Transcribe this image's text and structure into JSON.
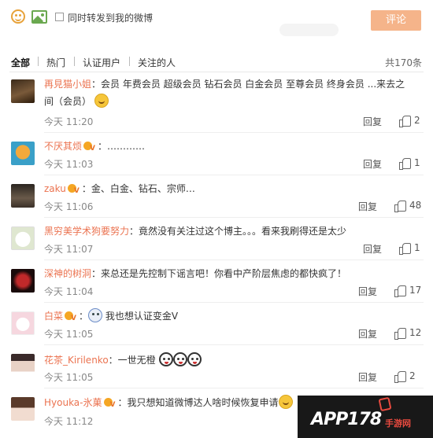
{
  "composer": {
    "emoji_icon": "smiley-icon",
    "image_icon": "picture-icon",
    "repost_label": "同时转发到我的微博",
    "submit_label": "评论"
  },
  "filters": {
    "tabs": [
      "全部",
      "热门",
      "认证用户",
      "关注的人"
    ],
    "total": "共170条"
  },
  "comments": [
    {
      "user": "再見猫小姐",
      "text": "：会员 年费会员 超级会员 钻石会员 白金会员 至尊会员 终身会员 ...来去之",
      "text2": "间（会员）",
      "time": "今天 11:20",
      "reply": "回复",
      "likes": "2"
    },
    {
      "user": "不厌其烦",
      "text": "：…………",
      "time": "今天 11:03",
      "reply": "回复",
      "likes": "1"
    },
    {
      "user": "zaku",
      "text": "：金、白金、钻石、宗师…",
      "time": "今天 11:06",
      "reply": "回复",
      "likes": "48"
    },
    {
      "user": "黑穷美学术狗要努力",
      "text": "：竟然没有关注过这个博主。。。看来我刷得还是太少",
      "time": "今天 11:07",
      "reply": "回复",
      "likes": "1"
    },
    {
      "user": "深神的树洞",
      "text": "：来总还是先控制下谣言吧！你看中产阶层焦虑的都快疯了！",
      "time": "今天 11:04",
      "reply": "回复",
      "likes": "17"
    },
    {
      "user": "白菜",
      "text": "我也想认证变金V",
      "time": "今天 11:05",
      "reply": "回复",
      "likes": "12"
    },
    {
      "user": "花茶_Kirilenko",
      "text": "：一世无橙",
      "time": "今天 11:05",
      "reply": "回复",
      "likes": "2"
    },
    {
      "user": "Hyouka-氷菓",
      "text": "：我只想知道微博达人啥时候恢复申请",
      "time": "今天 11:12",
      "reply": "",
      "likes": ""
    }
  ],
  "watermark": {
    "brand": "APP178",
    "sub": "手游网"
  },
  "colors": {
    "accent": "#eb7350",
    "submit_bg": "#f5b48a"
  }
}
